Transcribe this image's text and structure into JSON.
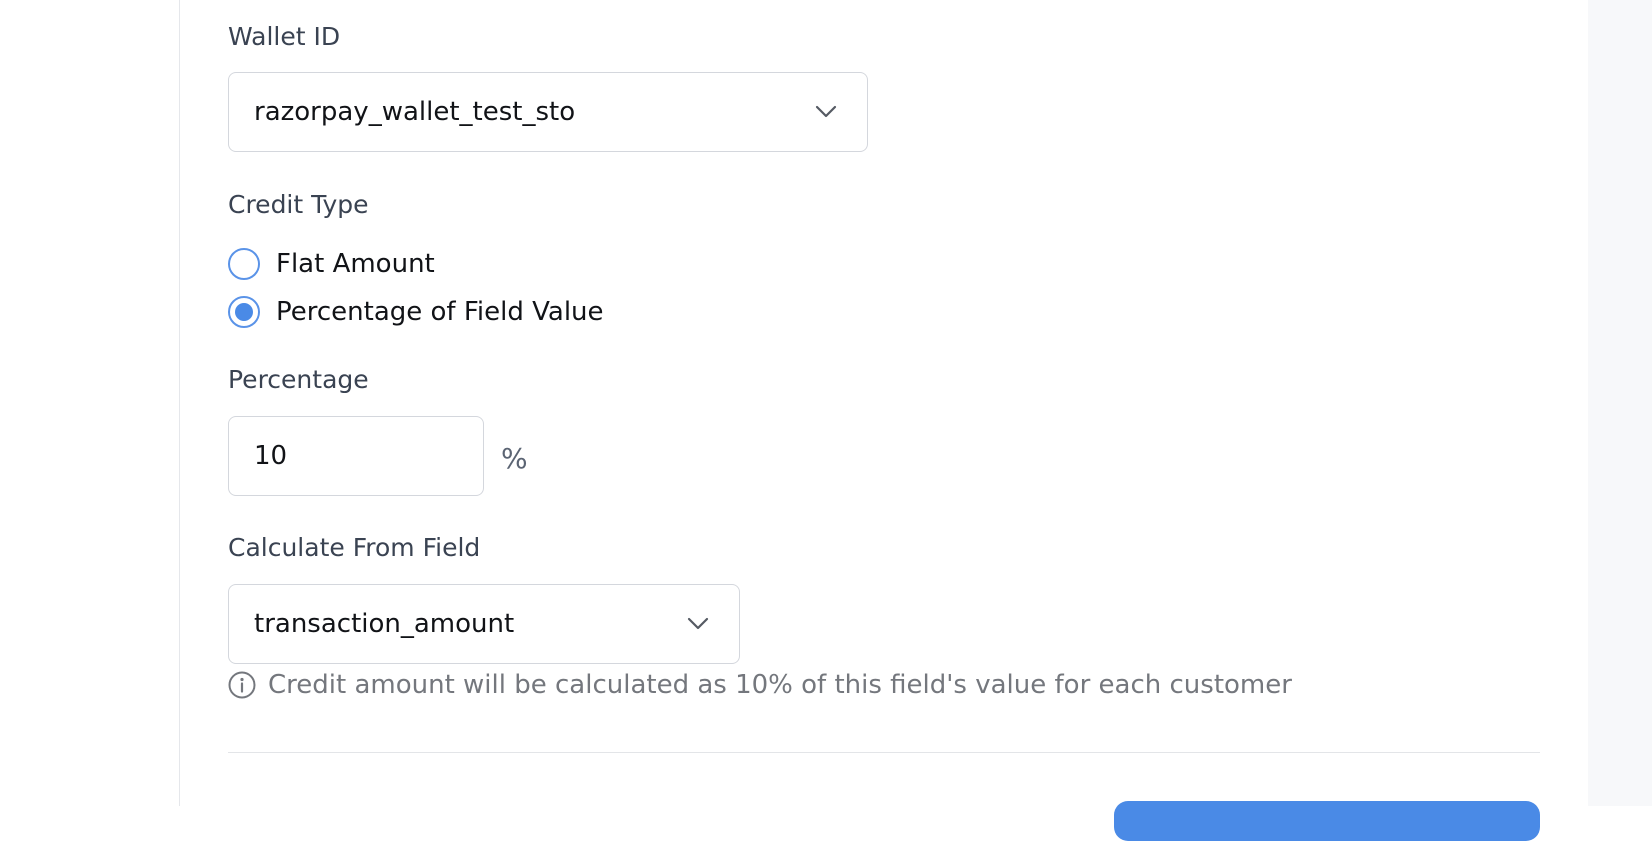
{
  "form": {
    "wallet_id": {
      "label": "Wallet ID",
      "value": "razorpay_wallet_test_sto"
    },
    "credit_type": {
      "label": "Credit Type",
      "options": [
        {
          "label": "Flat Amount",
          "selected": false
        },
        {
          "label": "Percentage of Field Value",
          "selected": true
        }
      ]
    },
    "percentage": {
      "label": "Percentage",
      "value": "10",
      "suffix": "%"
    },
    "calculate_from_field": {
      "label": "Calculate From Field",
      "value": "transaction_amount",
      "hint": "Credit amount will be calculated as 10% of this field's value for each customer"
    }
  },
  "colors": {
    "accent": "#4a8ae6",
    "label_text": "#3a4352",
    "hint_text": "#74777d",
    "border": "#d4d7dd"
  },
  "icons": {
    "dropdown": "chevron-down-icon",
    "hint": "info-icon"
  }
}
